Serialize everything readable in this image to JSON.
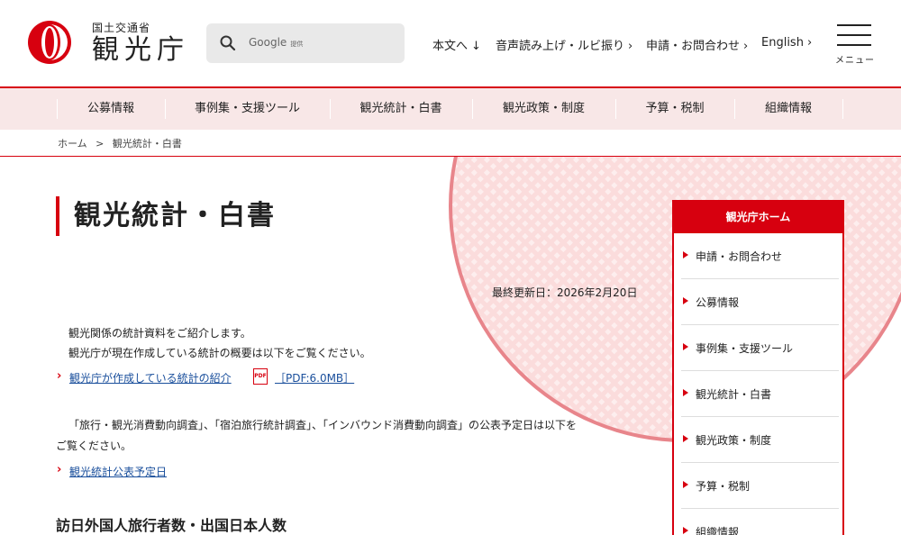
{
  "header": {
    "ministry": "国土交通省",
    "agency": "観光庁",
    "search_brand": "Google",
    "search_provided": "提供",
    "util_links": [
      {
        "label": "本文へ",
        "arrow": "↓"
      },
      {
        "label": "音声読み上げ・ルビ振り",
        "arrow": "›"
      },
      {
        "label": "申請・お問合わせ",
        "arrow": "›"
      },
      {
        "label": "English",
        "arrow": "›"
      }
    ],
    "menu_label": "メニュー"
  },
  "gnav": {
    "items": [
      "公募情報",
      "事例集・支援ツール",
      "観光統計・白書",
      "観光政策・制度",
      "予算・税制",
      "組織情報"
    ]
  },
  "breadcrumb": {
    "home": "ホーム",
    "separator": ">",
    "current": "観光統計・白書"
  },
  "main": {
    "title": "観光統計・白書",
    "updated": "最終更新日：2026年2月20日",
    "intro_line1": "観光関係の統計資料をご紹介します。",
    "intro_line2": "観光庁が現在作成している統計の概要は以下をご覧ください。",
    "link1_text": "観光庁が作成している統計の紹介",
    "pdf_icon_label": "PDF",
    "link1_meta": "［PDF:6.0MB］",
    "para2_line1": "「旅行・観光消費動向調査」、「宿泊旅行統計調査」、「インバウンド消費動向調査」の公表予定日は以下を",
    "para2_line2": "ご覧ください。",
    "link2_text": "観光統計公表予定日",
    "section_heading": "訪日外国人旅行者数・出国日本人数"
  },
  "side_nav": {
    "heading": "観光庁ホーム",
    "items": [
      "申請・お問合わせ",
      "公募情報",
      "事例集・支援ツール",
      "観光統計・白書",
      "観光政策・制度",
      "予算・税制",
      "組織情報"
    ]
  },
  "colors": {
    "accent": "#d7000f",
    "nav_bg": "#f8e7e7",
    "link": "#1a4f9c"
  }
}
